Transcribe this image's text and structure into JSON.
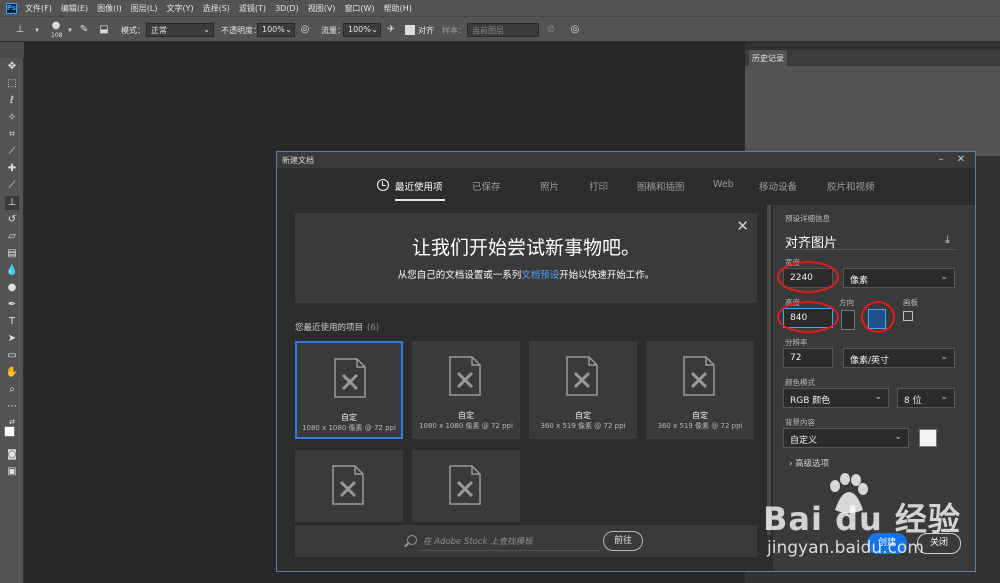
{
  "menu": {
    "logo": "Ps",
    "items": [
      "文件(F)",
      "编辑(E)",
      "图像(I)",
      "图层(L)",
      "文字(Y)",
      "选择(S)",
      "滤镜(T)",
      "3D(D)",
      "视图(V)",
      "窗口(W)",
      "帮助(H)"
    ]
  },
  "options_bar": {
    "brush_size": "108",
    "mode_label": "模式：",
    "mode_value": "正常",
    "opacity_label": "不透明度：",
    "opacity_value": "100%",
    "flow_label": "流量：",
    "flow_value": "100%",
    "align_label": "对齐",
    "sample_label": "样本：",
    "sample_value": "当前图层"
  },
  "panel": {
    "history_tab": "历史记录"
  },
  "dialog": {
    "title": "新建文档",
    "tabs": [
      "最近使用项",
      "已保存",
      "照片",
      "打印",
      "图稿和插图",
      "Web",
      "移动设备",
      "胶片和视频"
    ],
    "active_tab": "最近使用项",
    "welcome": {
      "title": "让我们开始尝试新事物吧。",
      "sub_before": "从您自己的文档设置或一系列",
      "sub_link": "文档预设",
      "sub_after": "开始以快速开始工作。"
    },
    "recent_label": "您最近使用的项目",
    "recent_count": "(6)",
    "cards": [
      {
        "name": "自定",
        "info": "1080 x 1080 像素 @ 72 ppi",
        "selected": true
      },
      {
        "name": "自定",
        "info": "1080 x 1080 像素 @ 72 ppi",
        "selected": false
      },
      {
        "name": "自定",
        "info": "360 x 519 像素 @ 72 ppi",
        "selected": false
      },
      {
        "name": "自定",
        "info": "360 x 519 像素 @ 72 ppi",
        "selected": false
      },
      {
        "name": "",
        "info": "",
        "selected": false
      },
      {
        "name": "",
        "info": "",
        "selected": false
      }
    ],
    "search": {
      "placeholder": "在 Adobe Stock 上查找模板",
      "go_label": "前往"
    },
    "preset": {
      "section_label": "预设详细信息",
      "name": "对齐图片",
      "width_label": "宽度",
      "width_value": "2240",
      "width_unit": "像素",
      "height_label": "高度",
      "height_value": "840",
      "orientation_label": "方向",
      "artboard_label": "画板",
      "resolution_label": "分辨率",
      "resolution_value": "72",
      "resolution_unit": "像素/英寸",
      "color_mode_label": "颜色模式",
      "color_mode_value": "RGB 颜色",
      "bit_depth_value": "8 位",
      "bg_label": "背景内容",
      "bg_value": "自定义",
      "advanced_label": "高级选项",
      "create_label": "创建",
      "close_label": "关闭"
    }
  },
  "watermark": {
    "brand": "Bai du 经验",
    "url": "jingyan.baidu.com"
  },
  "colors": {
    "accent_blue": "#1473e6",
    "link_blue": "#4da3ff",
    "annotation_red": "#e41a1a"
  }
}
